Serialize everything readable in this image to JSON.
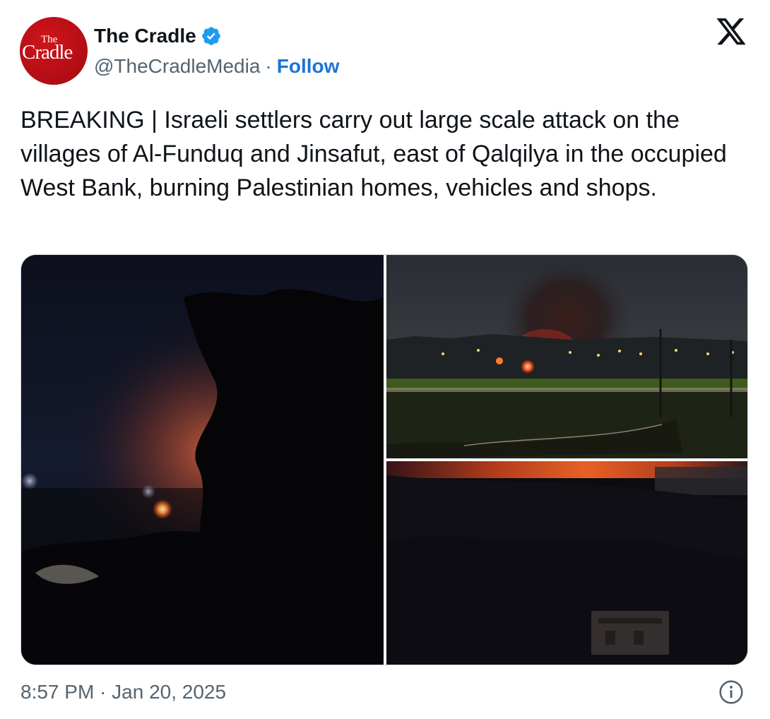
{
  "author": {
    "display_name": "The Cradle",
    "handle": "@TheCradleMedia",
    "separator": "·",
    "follow_label": "Follow",
    "verified": true,
    "avatar_text_small": "The",
    "avatar_text_big": "Cradle"
  },
  "tweet": {
    "text": "BREAKING | Israeli settlers carry out large scale attack on the villages of Al-Funduq and Jinsafut, east of Qalqilya in the occupied West Bank, burning Palestinian homes, vehicles and shops."
  },
  "media": {
    "photos": [
      {
        "icon": "night-fire-trees-photo"
      },
      {
        "icon": "smoke-over-town-photo"
      },
      {
        "icon": "burning-hillside-photo"
      }
    ]
  },
  "footer": {
    "timestamp": "8:57 PM · Jan 20, 2025"
  },
  "icons": {
    "platform": "x-logo-icon",
    "verified": "verified-badge-icon",
    "info": "info-icon"
  },
  "colors": {
    "follow": "#1d74d6",
    "verified_badge": "#1d9bf0",
    "avatar_red": "#c1121a",
    "muted_text": "#536471"
  }
}
